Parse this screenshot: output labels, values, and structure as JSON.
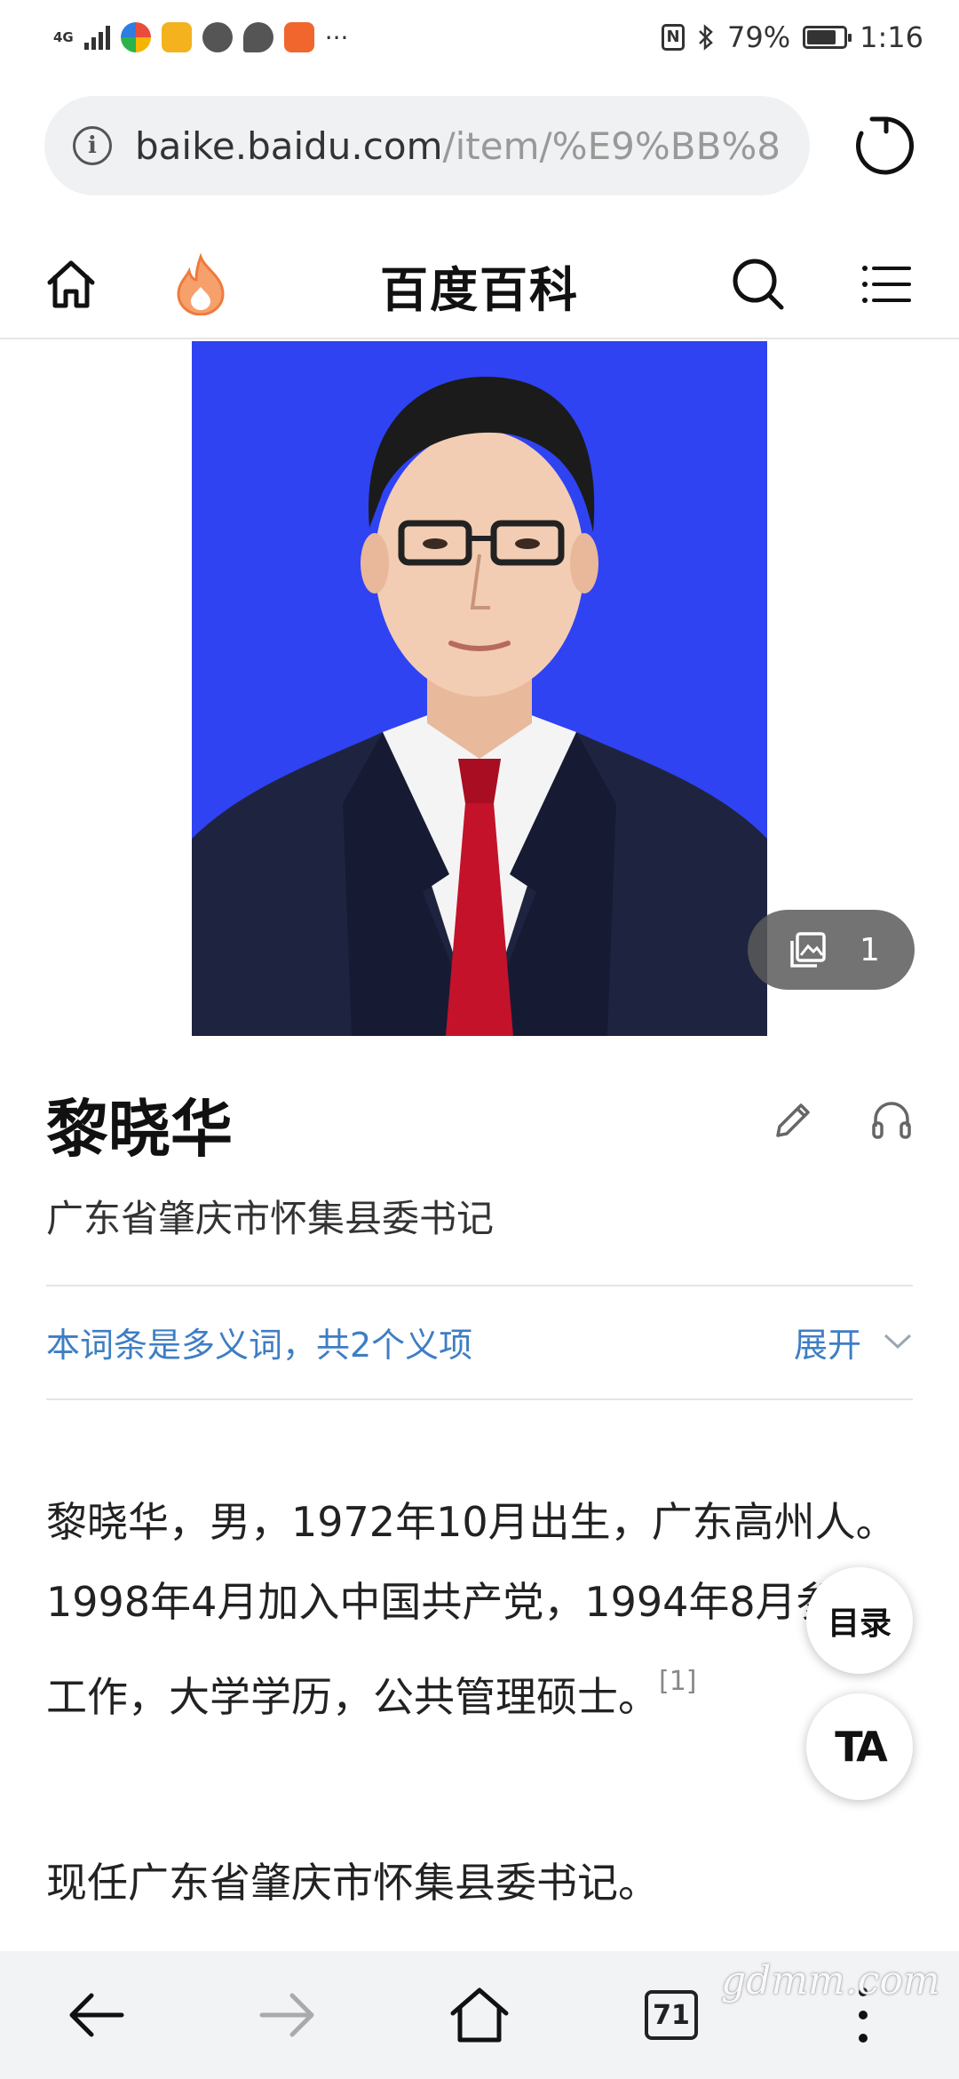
{
  "status_bar": {
    "network": "4G",
    "battery_text": "79%",
    "time": "1:16",
    "battery_level": 0.79,
    "more": "···"
  },
  "browser": {
    "url_host": "baike.baidu.com",
    "url_path": "/item/%E9%BB%8"
  },
  "header": {
    "title": "百度百科"
  },
  "album": {
    "count": "1"
  },
  "entry": {
    "title": "黎晓华",
    "subtitle": "广东省肇庆市怀集县委书记",
    "polysemy_text": "本词条是多义词，共2个义项",
    "expand_label": "展开",
    "summary_text": "黎晓华，男，1972年10月出生，广东高州人。1998年4月加入中国共产党，1994年8月参加工作，大学学历，公共管理硕士。",
    "summary_ref": "[1]",
    "current_post": "现任广东省肇庆市怀集县委书记。"
  },
  "floating": {
    "toc_label": "目录",
    "ta_label": "TA"
  },
  "bottom_bar": {
    "tab_count": "71"
  },
  "watermark": "gdmm.com"
}
